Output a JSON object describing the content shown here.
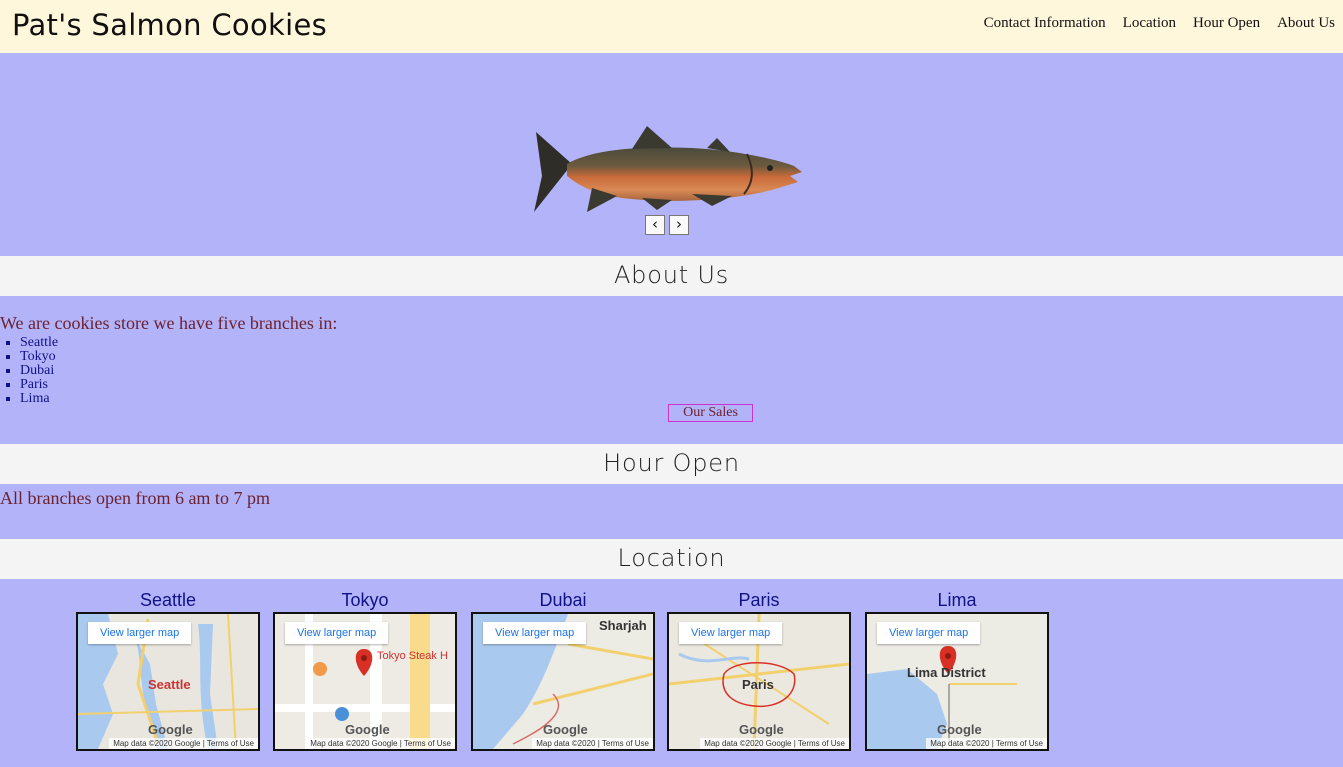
{
  "header": {
    "brand": "Pat's Salmon Cookies",
    "nav": [
      "Contact Information",
      "Location",
      "Hour Open",
      "About Us"
    ]
  },
  "carousel": {
    "prev": "‹",
    "next": "›"
  },
  "about": {
    "heading": "About Us",
    "intro": "We are cookies store we have five branches in:",
    "branches": [
      "Seattle",
      "Tokyo",
      "Dubai",
      "Paris",
      "Lima"
    ],
    "button": "Our Sales"
  },
  "hours": {
    "heading": "Hour Open",
    "text": "All branches open from 6 am to 7 pm"
  },
  "location": {
    "heading": "Location",
    "view_larger": "View larger map",
    "terms": "Terms of Use",
    "logo": "Google",
    "maps": [
      {
        "city": "Seattle",
        "attribution": "Map data ©2020 Google",
        "label": "Seattle"
      },
      {
        "city": "Tokyo",
        "attribution": "Map data ©2020 Google",
        "label": "Tokyo Steak H"
      },
      {
        "city": "Dubai",
        "attribution": "Map data ©2020",
        "label": "Sharjah"
      },
      {
        "city": "Paris",
        "attribution": "Map data ©2020 Google",
        "label": "Paris"
      },
      {
        "city": "Lima",
        "attribution": "Map data ©2020",
        "label": "Lima District"
      }
    ]
  }
}
